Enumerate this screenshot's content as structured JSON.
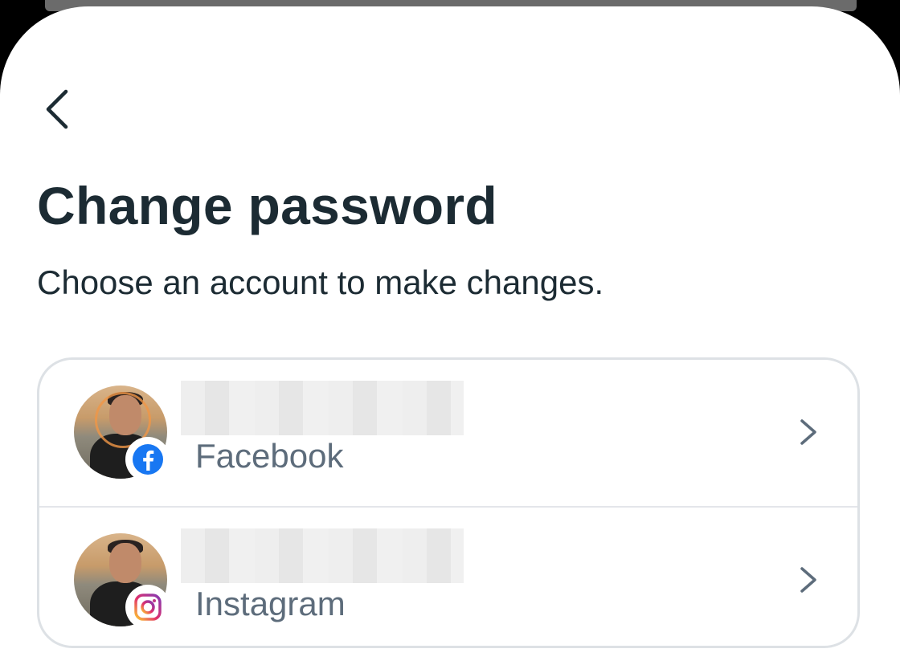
{
  "header": {
    "title": "Change password",
    "subtitle": "Choose an account to make changes."
  },
  "accounts": [
    {
      "platform": "Facebook",
      "badge_icon": "facebook-icon"
    },
    {
      "platform": "Instagram",
      "badge_icon": "instagram-icon"
    }
  ],
  "colors": {
    "title_text": "#1c2b33",
    "secondary_text": "#5d6c7b",
    "border": "#dde1e5",
    "facebook_blue": "#1877f2"
  }
}
